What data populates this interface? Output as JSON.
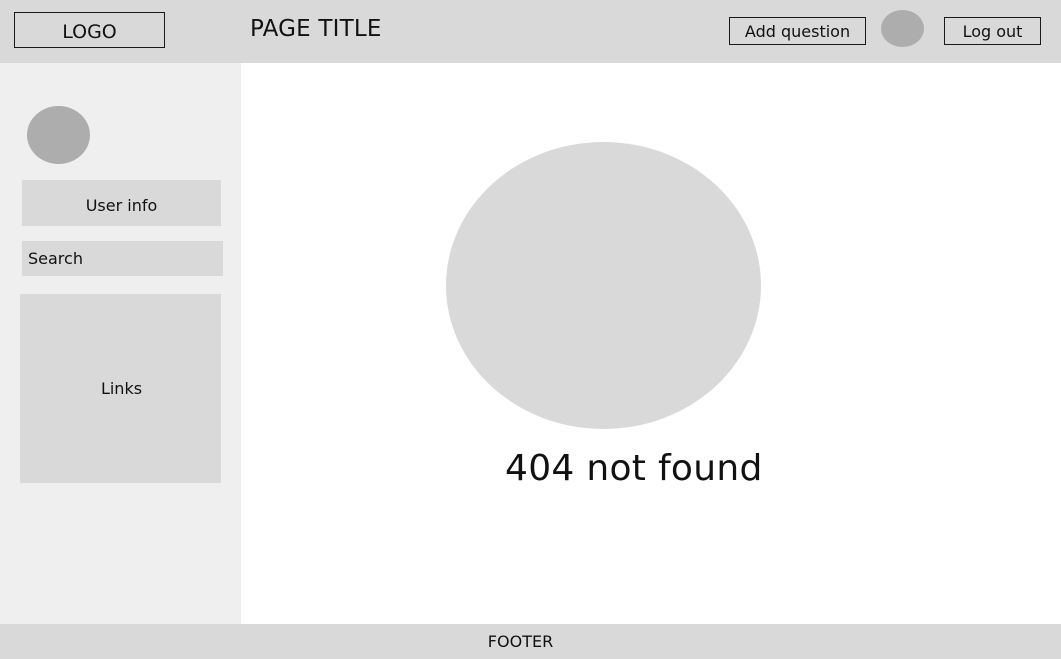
{
  "header": {
    "logo": "LOGO",
    "title": "PAGE TITLE",
    "add_question_label": "Add question",
    "logout_label": "Log out"
  },
  "sidebar": {
    "user_info": "User info",
    "search_label": "Search",
    "links_label": "Links"
  },
  "main": {
    "error_message": "404 not found"
  },
  "footer": {
    "label": "FOOTER"
  }
}
